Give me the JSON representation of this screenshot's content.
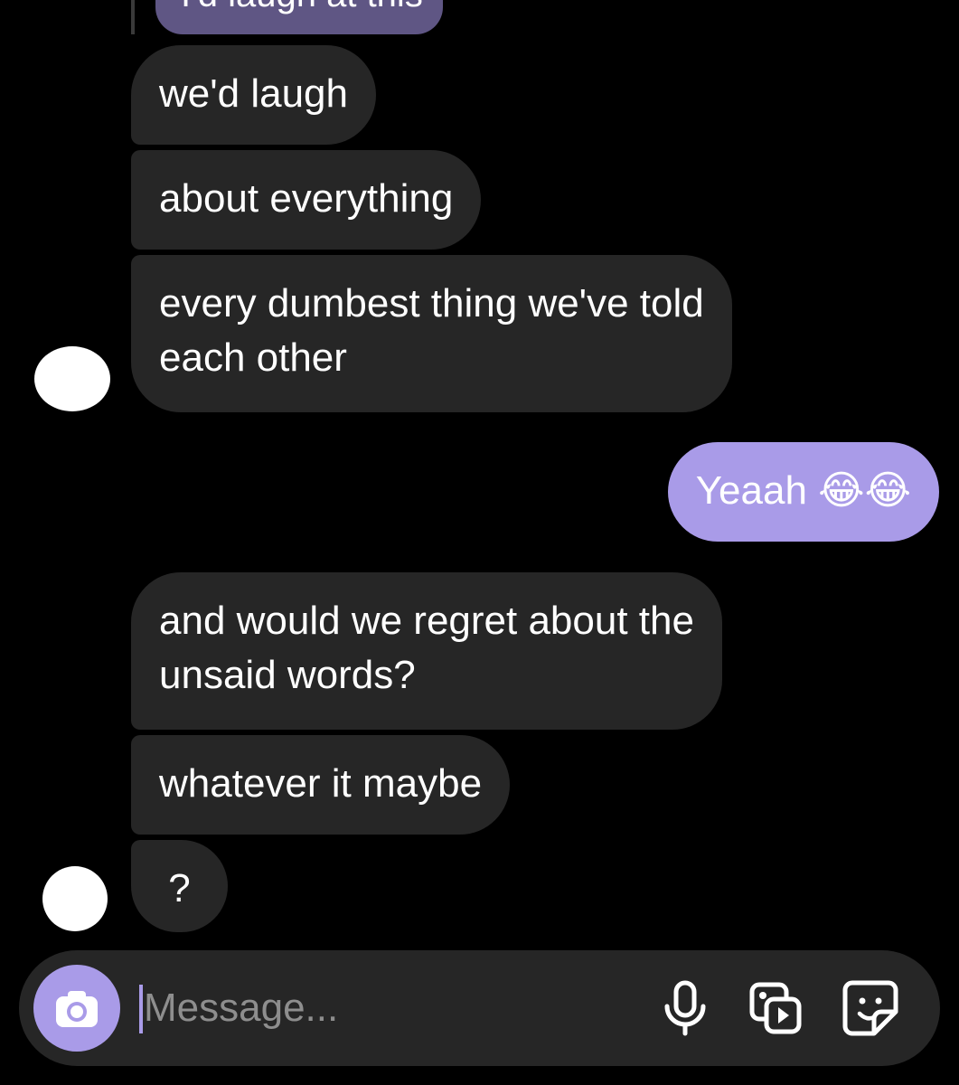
{
  "chat": {
    "reply_preview": "I'd laugh at this",
    "messages": [
      {
        "direction": "received",
        "text": "we'd laugh"
      },
      {
        "direction": "received",
        "text": "about everything"
      },
      {
        "direction": "received",
        "text": "every dumbest thing we've told each other",
        "line1": "every dumbest thing we've told",
        "line2": "each other"
      },
      {
        "direction": "sent",
        "text": "Yeaah 😂😂"
      },
      {
        "direction": "received",
        "text": "and would we regret about the unsaid words?",
        "line1": "and would we regret about the",
        "line2": "unsaid words?"
      },
      {
        "direction": "received",
        "text": "whatever it maybe"
      },
      {
        "direction": "received",
        "text": "?"
      }
    ]
  },
  "composer": {
    "placeholder": "Message...",
    "value": "",
    "icons": [
      "camera-icon",
      "microphone-icon",
      "gallery-icon",
      "sticker-icon"
    ]
  },
  "colors": {
    "background": "#000000",
    "received_bubble": "#262626",
    "sent_bubble": "#a99be8",
    "accent": "#a99be8",
    "reply_bubble": "#5f5684"
  }
}
